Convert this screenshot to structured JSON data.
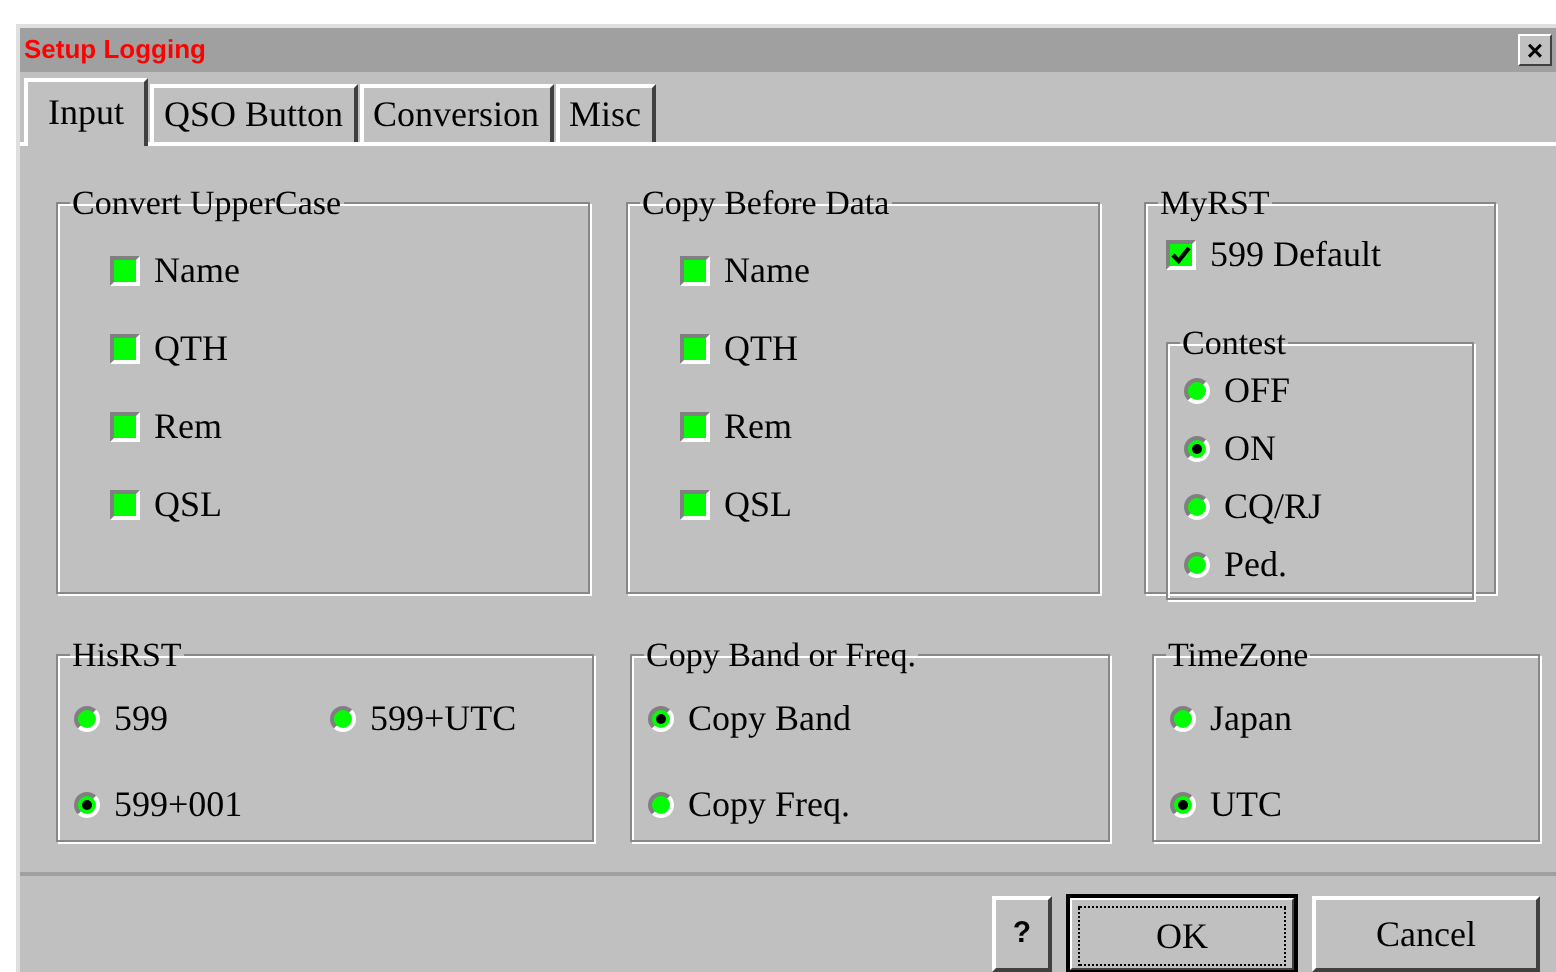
{
  "window": {
    "title": "Setup Logging",
    "close": "×"
  },
  "tabs": [
    {
      "label": "Input",
      "selected": true
    },
    {
      "label": "QSO Button",
      "selected": false
    },
    {
      "label": "Conversion",
      "selected": false
    },
    {
      "label": "Misc",
      "selected": false
    }
  ],
  "rows": [
    {
      "groups": [
        {
          "title": "Convert UpperCase",
          "kind": "list",
          "items": [
            {
              "kind": "checkbox",
              "label": "Name",
              "checked": false
            },
            {
              "kind": "checkbox",
              "label": "QTH",
              "checked": false
            },
            {
              "kind": "checkbox",
              "label": "Rem",
              "checked": false
            },
            {
              "kind": "checkbox",
              "label": "QSL",
              "checked": false
            }
          ]
        },
        {
          "title": "Copy Before Data",
          "kind": "list",
          "items": [
            {
              "kind": "checkbox",
              "label": "Name",
              "checked": false
            },
            {
              "kind": "checkbox",
              "label": "QTH",
              "checked": false
            },
            {
              "kind": "checkbox",
              "label": "Rem",
              "checked": false
            },
            {
              "kind": "checkbox",
              "label": "QSL",
              "checked": false
            }
          ]
        },
        {
          "title": "MyRST",
          "kind": "compact",
          "items": [
            {
              "kind": "checkbox",
              "label": "599 Default",
              "checked": true
            }
          ],
          "subgroup": {
            "title": "Contest",
            "items": [
              {
                "kind": "radio",
                "label": "OFF",
                "selected": false
              },
              {
                "kind": "radio",
                "label": "ON",
                "selected": true
              },
              {
                "kind": "radio",
                "label": "CQ/RJ",
                "selected": false
              },
              {
                "kind": "radio",
                "label": "Ped.",
                "selected": false
              }
            ]
          }
        }
      ]
    },
    {
      "groups": [
        {
          "title": "HisRST",
          "kind": "grid",
          "items": [
            {
              "kind": "radio",
              "label": "599",
              "selected": false
            },
            {
              "kind": "radio",
              "label": "599+UTC",
              "selected": false
            },
            {
              "kind": "radio",
              "label": "599+001",
              "selected": true
            }
          ]
        },
        {
          "title": "Copy Band or Freq.",
          "kind": "list",
          "items": [
            {
              "kind": "radio",
              "label": "Copy Band",
              "selected": true
            },
            {
              "kind": "radio",
              "label": "Copy Freq.",
              "selected": false
            }
          ]
        },
        {
          "title": "TimeZone",
          "kind": "list",
          "items": [
            {
              "kind": "radio",
              "label": "Japan",
              "selected": false
            },
            {
              "kind": "radio",
              "label": "UTC",
              "selected": true
            }
          ]
        }
      ]
    }
  ],
  "buttons": [
    {
      "label": "?",
      "focused": false
    },
    {
      "label": "OK",
      "focused": true
    },
    {
      "label": "Cancel",
      "focused": false
    }
  ]
}
